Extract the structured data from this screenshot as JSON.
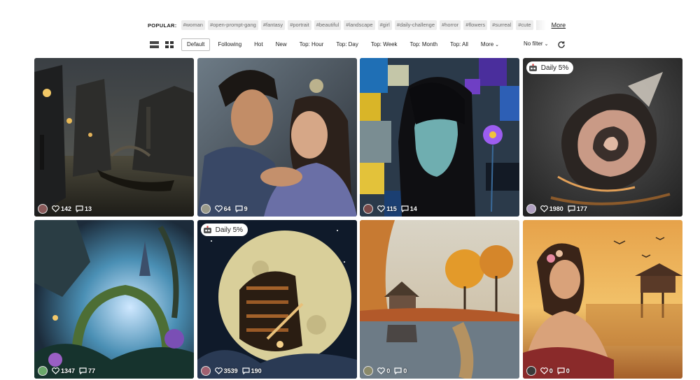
{
  "popular": {
    "label": "POPULAR:",
    "tags": [
      "#woman",
      "#open-prompt-gang",
      "#fantasy",
      "#portrait",
      "#beautiful",
      "#landscape",
      "#girl",
      "#daily-challenge",
      "#horror",
      "#flowers",
      "#surreal",
      "#cute"
    ],
    "more_label": "More"
  },
  "toolbar": {
    "view_icons": [
      "list-view-icon",
      "grid-view-icon"
    ],
    "tabs": [
      "Default",
      "Following",
      "Hot",
      "New",
      "Top: Hour",
      "Top: Day",
      "Top: Week",
      "Top: Month",
      "Top: All",
      "More"
    ],
    "active_tab": "Default",
    "filter_label": "No filter",
    "refresh_icon": "refresh-icon"
  },
  "badge_label": "Daily 5%",
  "cards": [
    {
      "likes": "142",
      "comments": "13",
      "subject": "gothic canal city at night with gondola",
      "badge": false
    },
    {
      "likes": "64",
      "comments": "9",
      "subject": "romantic couple embracing in the rain",
      "badge": false
    },
    {
      "likes": "115",
      "comments": "14",
      "subject": "woman with bob hair on mosaic background with purple flower",
      "badge": false
    },
    {
      "likes": "1980",
      "comments": "177",
      "subject": "abstract spiral paper rose sculpture",
      "badge": true
    },
    {
      "likes": "1347",
      "comments": "77",
      "subject": "fantasy garden with glowing arch and castle",
      "badge": false
    },
    {
      "likes": "3539",
      "comments": "190",
      "subject": "library inside the moon with reader",
      "badge": true
    },
    {
      "likes": "0",
      "comments": "0",
      "subject": "autumn cottage by a lake",
      "badge": false
    },
    {
      "likes": "0",
      "comments": "0",
      "subject": "woman at sunset by lake with stilt house and birds",
      "badge": false
    }
  ]
}
